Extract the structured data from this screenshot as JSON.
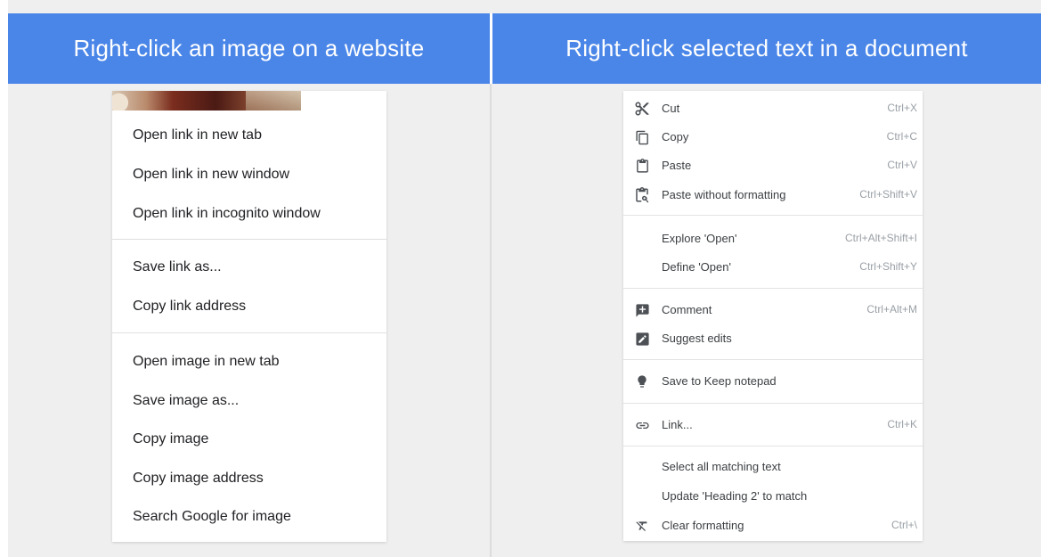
{
  "header": {
    "left_title": "Right-click an image on a website",
    "right_title": "Right-click selected text in a document"
  },
  "image_menu": {
    "groups": [
      [
        "Open link in new tab",
        "Open link in new window",
        "Open link in incognito window"
      ],
      [
        "Save link as...",
        "Copy link address"
      ],
      [
        "Open image in new tab",
        "Save image as...",
        "Copy image",
        "Copy image address",
        "Search Google for image"
      ]
    ]
  },
  "doc_menu": {
    "items": [
      {
        "label": "Cut",
        "shortcut": "Ctrl+X",
        "icon": "scissors-icon"
      },
      {
        "label": "Copy",
        "shortcut": "Ctrl+C",
        "icon": "copy-icon"
      },
      {
        "label": "Paste",
        "shortcut": "Ctrl+V",
        "icon": "clipboard-icon"
      },
      {
        "label": "Paste without formatting",
        "shortcut": "Ctrl+Shift+V",
        "icon": "paste-plain-icon"
      },
      {
        "label": "Explore 'Open'",
        "shortcut": "Ctrl+Alt+Shift+I",
        "icon": ""
      },
      {
        "label": "Define 'Open'",
        "shortcut": "Ctrl+Shift+Y",
        "icon": ""
      },
      {
        "label": "Comment",
        "shortcut": "Ctrl+Alt+M",
        "icon": "add-comment-icon"
      },
      {
        "label": "Suggest edits",
        "shortcut": "",
        "icon": "suggest-edits-icon"
      },
      {
        "label": "Save to Keep notepad",
        "shortcut": "",
        "icon": "lightbulb-icon"
      },
      {
        "label": "Link...",
        "shortcut": "Ctrl+K",
        "icon": "link-icon"
      },
      {
        "label": "Select all matching text",
        "shortcut": "",
        "icon": ""
      },
      {
        "label": "Update 'Heading 2' to match",
        "shortcut": "",
        "icon": ""
      },
      {
        "label": "Clear formatting",
        "shortcut": "Ctrl+\\",
        "icon": "clear-formatting-icon"
      }
    ]
  },
  "colors": {
    "header_background": "#4a86e8",
    "panel_background": "#efefef",
    "menu_background": "#ffffff"
  }
}
